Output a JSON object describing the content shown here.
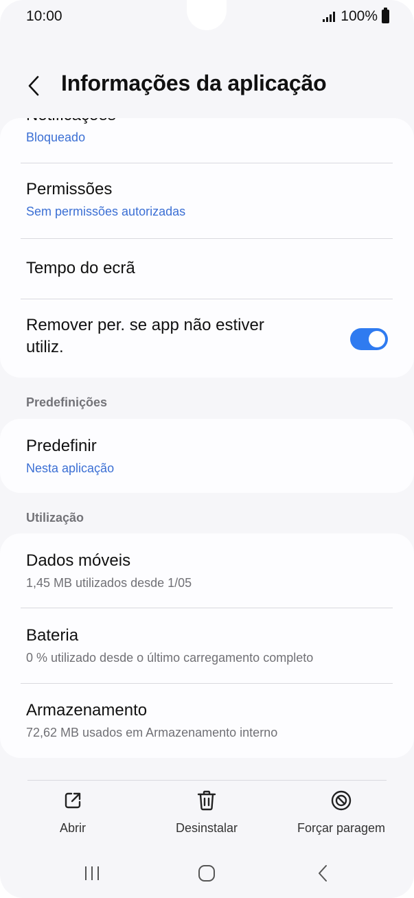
{
  "status_bar": {
    "time": "10:00",
    "battery_text": "100%"
  },
  "header": {
    "title": "Informações da aplicação",
    "back_icon": "chevron-left-icon"
  },
  "card_top": {
    "notifications": {
      "title": "Notificações",
      "subtitle": "Bloqueado"
    },
    "permissions": {
      "title": "Permissões",
      "subtitle": "Sem permissões autorizadas"
    },
    "screen_time": {
      "title": "Tempo do ecrã"
    },
    "remove_permissions": {
      "title_line1": "Remover per. se app não estiver",
      "title_line2": "utiliz.",
      "toggle_on": true
    }
  },
  "defaults_section": {
    "label": "Predefinições",
    "item": {
      "title": "Predefinir",
      "subtitle": "Nesta aplicação"
    }
  },
  "usage_section": {
    "label": "Utilização",
    "items": [
      {
        "title": "Dados móveis",
        "subtitle": "1,45 MB utilizados desde 1/05"
      },
      {
        "title": "Bateria",
        "subtitle": "0 % utilizado desde o último carregamento completo"
      },
      {
        "title": "Armazenamento",
        "subtitle": "72,62 MB usados em Armazenamento interno"
      }
    ]
  },
  "actions": [
    {
      "label": "Abrir",
      "icon": "open-external-icon"
    },
    {
      "label": "Desinstalar",
      "icon": "trash-icon"
    },
    {
      "label": "Forçar paragem",
      "icon": "block-icon"
    }
  ],
  "colors": {
    "accent_blue": "#3b6fd4",
    "toggle_blue": "#2f7bf0",
    "background": "#f6f6f9"
  }
}
